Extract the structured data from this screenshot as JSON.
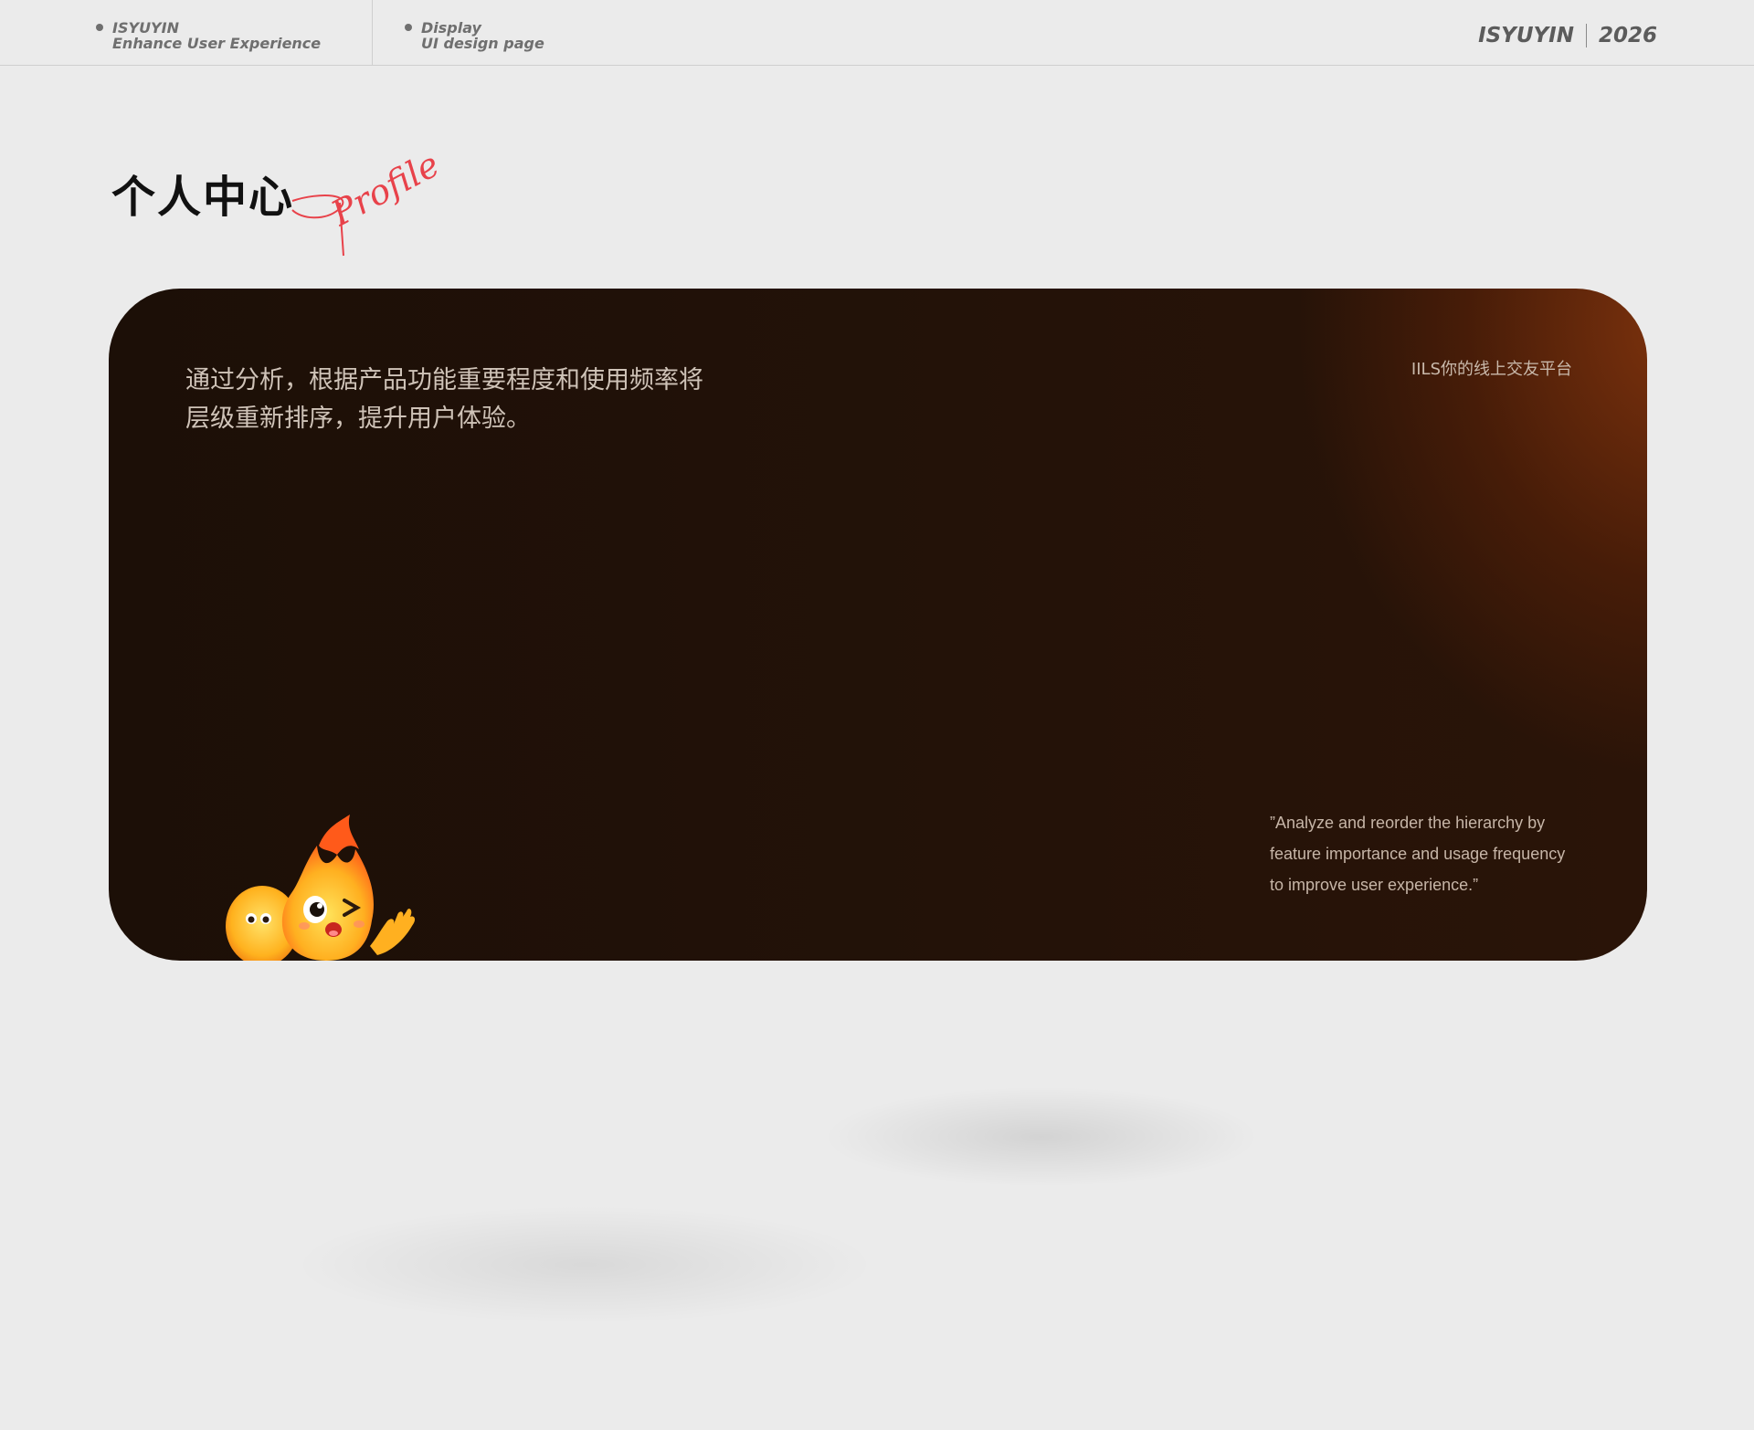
{
  "header": {
    "left_block": {
      "line1": "ISYUYIN",
      "line2": "Enhance User Experience"
    },
    "middle_block": {
      "line1": "Display",
      "line2": "UI design page"
    },
    "brand_name": "ISYUYIN",
    "brand_year": "2026"
  },
  "section": {
    "title": "个人中心",
    "script_word": "Profile"
  },
  "card": {
    "description_lines": [
      "通过分析，根据产品功能重要程度和使用频率将",
      "层级重新排序，提升用户体验。"
    ],
    "platform_label": "IILS你的线上交友平台",
    "quote_lines": [
      "”Analyze and reorder the hierarchy by",
      "feature importance and usage frequency",
      "to improve user experience.”"
    ],
    "mascot": "fire-mascot-waving",
    "colors": {
      "card_dark": "#1c0f07",
      "card_glow": "#82340e",
      "accent_script": "#e8424a"
    }
  }
}
